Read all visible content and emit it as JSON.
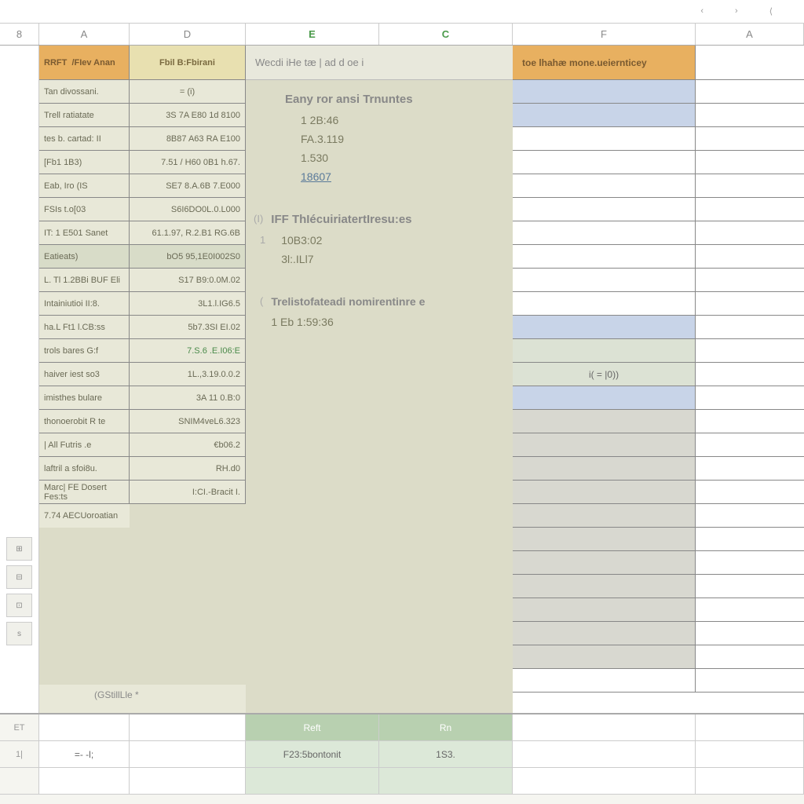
{
  "ruler": {
    "m1": "‹",
    "m2": "›",
    "m3": "⟨"
  },
  "columns": {
    "gutter": "8",
    "a": "A",
    "d": "D",
    "e": "E",
    "c": "C",
    "f": "F",
    "g": "A"
  },
  "table": {
    "header_a": "RRFT",
    "header_a2": "/FIev Anan",
    "header_d": "Fbil B:Fbirani",
    "rows": [
      {
        "a": "Tan divossani.",
        "d": "= (i)"
      },
      {
        "a": "Trell ratiatate",
        "d": "3S 7A E80 1d 8100"
      },
      {
        "a": "tes b. cartad: II",
        "d": "8B87 A63 RA E100"
      },
      {
        "a": "[Fb1 1B3)",
        "d": "7.51 / H60 0B1 h.67."
      },
      {
        "a": "Eab, Iro (IS",
        "d": "SE7 8.A.6B 7.E000"
      },
      {
        "a": "FSIs t.o[03",
        "d": "S6I6DO0L.0.L000"
      },
      {
        "a": "IT: 1 E501 Sanet",
        "d": "61.1.97, R.2.B1 RG.6B"
      },
      {
        "a": "Eatieats)",
        "d": "bO5 95,1E0I002S0"
      },
      {
        "a": "L. Tl 1.2BBi BUF Eli",
        "d": "S17 B9:0.0M.02"
      },
      {
        "a": "Intainiutioi II:8.",
        "d": "3L1.l.IG6.5"
      },
      {
        "a": "ha.L Ft1 l.CB:ss",
        "d": "5b7.3SI EI.02"
      },
      {
        "a": "trols bares G:f",
        "d": "7.S.6 .E.I06:E",
        "green": true
      },
      {
        "a": "haiver iest so3",
        "d": "1L.,3.19.0.0.2"
      },
      {
        "a": "imisthes bulare",
        "d": "3A 11 0.B:0"
      },
      {
        "a": "thonoerobit R te",
        "d": "SNIM4veL6.323"
      },
      {
        "a": "| All Futris .e",
        "d": "€b06.2"
      },
      {
        "a": "laftril a sfoi8u.",
        "d": "RH.d0"
      },
      {
        "a": "Marc| FE Dosert Fes:ts",
        "d": "I:CI.-Bracit I."
      },
      {
        "a": "7.74 AECUoroatian",
        "d": ""
      }
    ]
  },
  "middle": {
    "header": "Wecdi iHe tæ | ad d oe i",
    "block1_title": "Eany ror ansi Trnuntes",
    "block1_vals": [
      "1 2B:46",
      "FA.3.119",
      "1.530"
    ],
    "block1_link": "18607",
    "block2_bullet": "(I)",
    "block2_title": "IFF ThIécuiriatertIresu:es",
    "block2_num": "1",
    "block2_vals": [
      "10B3:02",
      "3l:.ILl7"
    ],
    "block3_bullet": "(",
    "block3_title": "Trelistofateadi nomirentinre e",
    "block3_val": "1 Eb 1:59:36"
  },
  "right": {
    "header": "toe lhahæ mone.ueiernticey",
    "formula": "i( = |0))"
  },
  "sheet_label": "(GStillLle *",
  "bottom": {
    "r1": {
      "g": "ET",
      "e": "Reft",
      "c": "Rn"
    },
    "r2": {
      "g": "1|",
      "a": "=- -l;",
      "e": "F23:5bontonit",
      "c": "1S3."
    }
  }
}
